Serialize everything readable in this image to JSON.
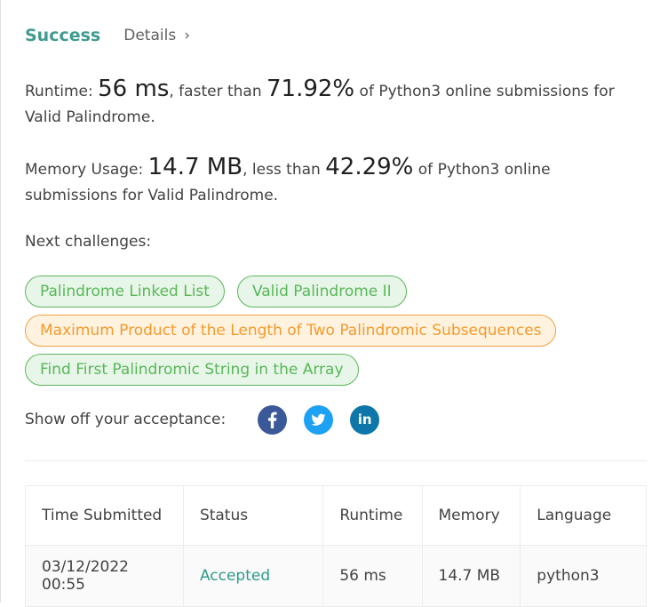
{
  "result": {
    "status": "Success",
    "details_label": "Details",
    "details_chevron": "›"
  },
  "runtime": {
    "label": "Runtime: ",
    "value": "56 ms",
    "mid": ", faster than ",
    "percent": "71.92%",
    "tail": " of Python3 online submissions for Valid Palindrome."
  },
  "memory": {
    "label": "Memory Usage: ",
    "value": "14.7 MB",
    "mid": ", less than ",
    "percent": "42.29%",
    "tail": " of Python3 online submissions for Valid Palindrome."
  },
  "next_challenges": {
    "label": "Next challenges:",
    "items": [
      {
        "label": "Palindrome Linked List",
        "difficulty": "easy"
      },
      {
        "label": "Valid Palindrome II",
        "difficulty": "easy"
      },
      {
        "label": "Maximum Product of the Length of Two Palindromic Subsequences",
        "difficulty": "medium"
      },
      {
        "label": "Find First Palindromic String in the Array",
        "difficulty": "easy"
      }
    ]
  },
  "share": {
    "label": "Show off your acceptance:",
    "icons": [
      "facebook-icon",
      "twitter-icon",
      "linkedin-icon"
    ],
    "linkedin_text": "in"
  },
  "colors": {
    "success": "#3f9b8f",
    "easy_border": "#5cb85c",
    "medium_border": "#f0a040",
    "facebook": "#3b5998",
    "twitter": "#1da1f2",
    "linkedin": "#0e76a8"
  },
  "submissions": {
    "headers": [
      "Time Submitted",
      "Status",
      "Runtime",
      "Memory",
      "Language"
    ],
    "rows": [
      [
        "03/12/2022 00:55",
        "Accepted",
        "56 ms",
        "14.7 MB",
        "python3"
      ]
    ]
  }
}
